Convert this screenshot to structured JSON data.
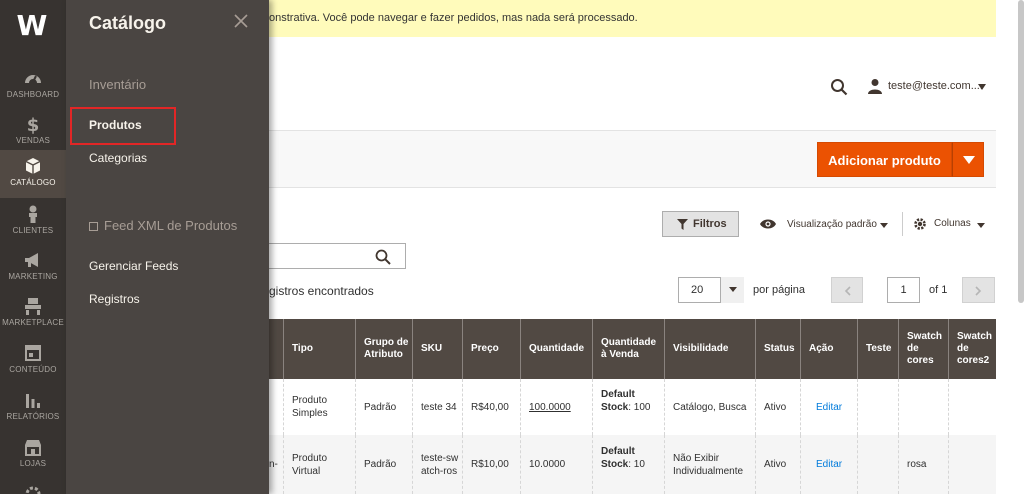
{
  "sidebar": {
    "logo": "W",
    "items": [
      {
        "label": "DASHBOARD",
        "icon": "dashboard-icon"
      },
      {
        "label": "VENDAS",
        "icon": "dollar-icon"
      },
      {
        "label": "CATÁLOGO",
        "icon": "box-icon"
      },
      {
        "label": "CLIENTES",
        "icon": "person-icon"
      },
      {
        "label": "MARKETING",
        "icon": "megaphone-icon"
      },
      {
        "label": "MARKETPLACE",
        "icon": "marketplace-icon"
      },
      {
        "label": "CONTEÚDO",
        "icon": "layout-icon"
      },
      {
        "label": "RELATÓRIOS",
        "icon": "bar-chart-icon"
      },
      {
        "label": "LOJAS",
        "icon": "store-icon"
      }
    ]
  },
  "flyout": {
    "title": "Catálogo",
    "sections": [
      {
        "label": "Inventário",
        "links": [
          "Produtos",
          "Categorias"
        ]
      },
      {
        "label": "Feed XML de Produtos",
        "links": [
          "Gerenciar Feeds",
          "Registros"
        ]
      }
    ]
  },
  "notice": {
    "text": "onstrativa. Você pode navegar e fazer pedidos, mas nada será processado."
  },
  "header": {
    "user": "teste@teste.com...."
  },
  "actions": {
    "add_product": "Adicionar produto"
  },
  "toolbar": {
    "filters": "Filtros",
    "view": "Visualização padrão",
    "columns": "Colunas",
    "records": "gistros encontrados",
    "per_page_value": "20",
    "per_page_label": "por página",
    "page": "1",
    "of": "of 1"
  },
  "grid": {
    "headers": [
      "Tipo",
      "Grupo de Atributo",
      "SKU",
      "Preço",
      "Quantidade",
      "Quantidade à Venda",
      "Visibilidade",
      "Status",
      "Ação",
      "Teste",
      "Swatch de cores",
      "Swatch de cores2"
    ],
    "rows": [
      {
        "tipo": "Produto Simples",
        "grupo": "Padrão",
        "sku": "teste 34",
        "preco": "R$40,00",
        "quantidade": "100.0000",
        "venda_label": "Default Stock",
        "venda_value": ": 100",
        "visibilidade": "Catálogo, Busca",
        "status": "Ativo",
        "acao": "Editar",
        "teste": "",
        "swatch": "",
        "swatch2": ""
      },
      {
        "prefix": "n-",
        "tipo": "Produto Virtual",
        "grupo": "Padrão",
        "sku": "teste-swatch-ros",
        "preco": "R$10,00",
        "quantidade": "10.0000",
        "venda_label": "Default Stock",
        "venda_value": ": 10",
        "visibilidade": "Não Exibir Individualmente",
        "status": "Ativo",
        "acao": "Editar",
        "teste": "",
        "swatch": "rosa",
        "swatch2": ""
      }
    ]
  }
}
